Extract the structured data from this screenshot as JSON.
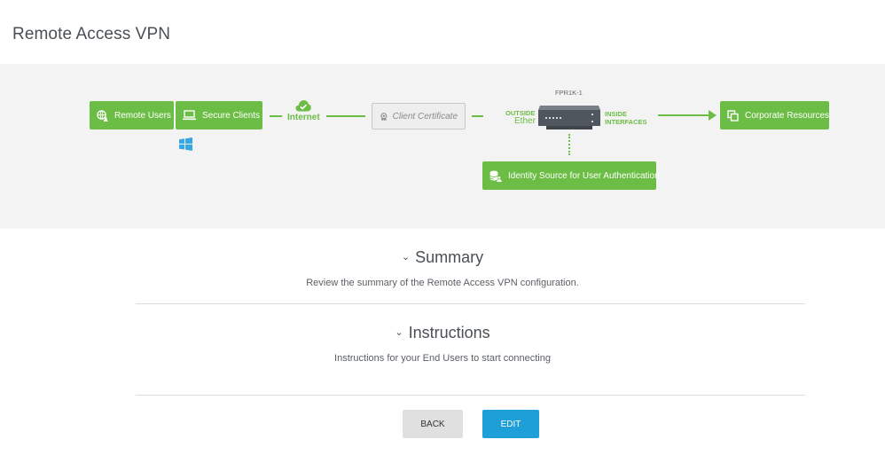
{
  "header": {
    "title": "Remote Access VPN"
  },
  "diagram": {
    "remote_users": "Remote Users",
    "secure_clients": "Secure Clients",
    "internet": "Internet",
    "client_certificate": "Client Certificate",
    "device_name": "FPR1K-1",
    "outside_label": "OUTSIDE",
    "outside_iface": "Ether",
    "inside_label_1": "INSIDE",
    "inside_label_2": "INTERFACES",
    "identity_source": "Identity Source for User Authentication",
    "corporate_resources": "Corporate Resources",
    "brand_green": "#6cbd45"
  },
  "summary": {
    "title": "Summary",
    "description": "Review the summary of the Remote Access VPN configuration."
  },
  "instructions": {
    "title": "Instructions",
    "description": "Instructions for your End Users to start connecting"
  },
  "actions": {
    "back": "BACK",
    "edit": "EDIT"
  }
}
